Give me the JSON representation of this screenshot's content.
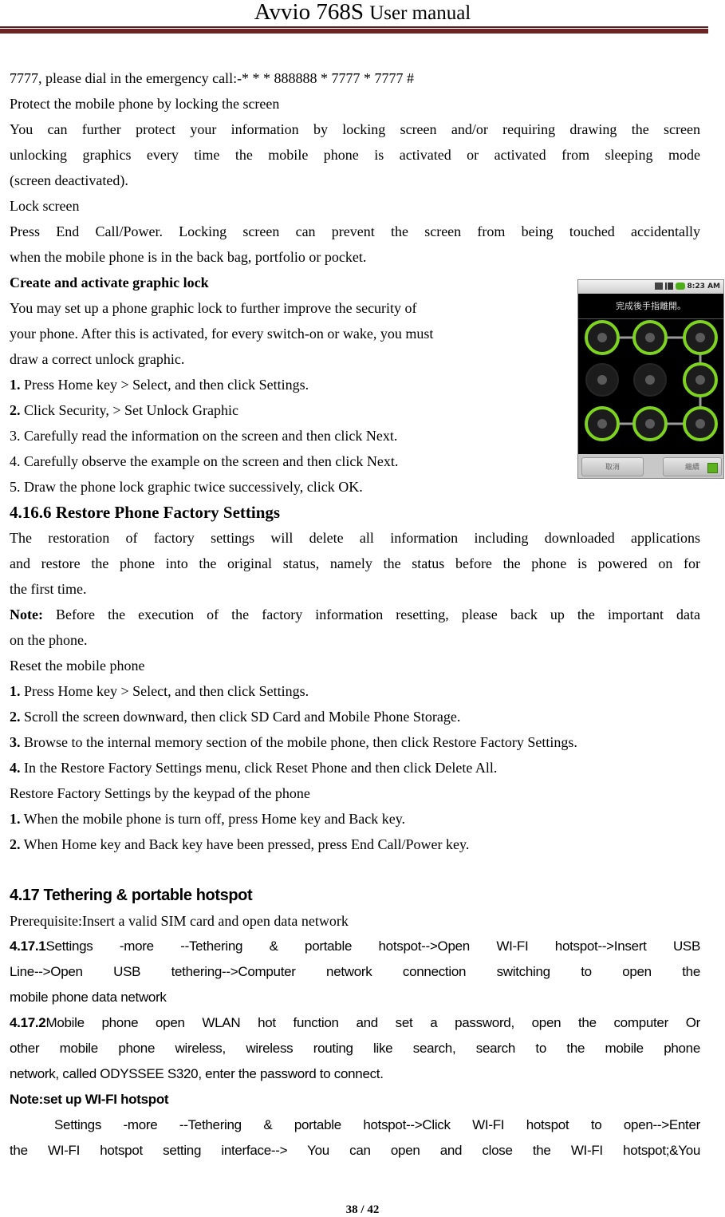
{
  "header": {
    "model": "Avvio 768S",
    "title": "User manual",
    "rule_color": "#6b2424"
  },
  "lines": {
    "l01": "7777, please dial in the emergency call:-* * * 888888 * 7777 * 7777 #",
    "l02": "Protect the mobile phone by locking the screen",
    "l03": "You can further protect your information by locking screen and/or requiring drawing the screen",
    "l04": "unlocking graphics every time the mobile phone is activated or activated from sleeping mode",
    "l05": "(screen deactivated).",
    "l06": "Lock screen",
    "l07": "Press End Call/Power. Locking screen can prevent the screen from being touched accidentally",
    "l08": "when the mobile phone is in the back bag, portfolio or pocket.",
    "l09": "Create and activate graphic lock",
    "l10": "You may set up a phone graphic lock to further improve the security of",
    "l11": "your phone. After this is activated, for every switch-on or wake, you must",
    "l12": "draw a correct unlock graphic.",
    "l13_num": "1.",
    "l13": " Press Home key > Select, and then click Settings.",
    "l14_num": "2.",
    "l14": " Click Security, > Set Unlock Graphic",
    "l15": "3. Carefully read the information on the screen and then click Next.",
    "l16": "4. Carefully observe the example on the screen and then click Next.",
    "l17": "5. Draw the phone lock graphic twice successively, click OK.",
    "l18": "4.16.6 Restore Phone Factory Settings",
    "l19": "The restoration of factory settings will delete all information including downloaded applications",
    "l20": "and restore the phone into the original status, namely the status before the phone is powered on for",
    "l21": "the first time.",
    "l22_label": "Note:",
    "l22": " Before the execution of the factory information resetting, please back up the important data",
    "l23": "on the phone.",
    "l24": "Reset the mobile phone",
    "l25_num": "1.",
    "l25": " Press Home key > Select, and then click Settings.",
    "l26_num": "2.",
    "l26": " Scroll the screen downward, then click SD Card and Mobile Phone Storage.",
    "l27_num": "3.",
    "l27": " Browse to the internal memory section of the mobile phone, then click Restore Factory Settings.",
    "l28_num": "4.",
    "l28": " In the Restore Factory Settings menu, click Reset Phone and then click Delete All.",
    "l29": "Restore Factory Settings by the keypad of the phone",
    "l30_num": "1.",
    "l30": " When the mobile phone is turn off, press Home key and Back key.",
    "l31_num": "2.",
    "l31": " When Home key and Back key have been pressed, press End Call/Power key.",
    "l32": "4.17 Tethering & portable hotspot",
    "l33": "Prerequisite:Insert a valid SIM card and open data network",
    "l34_num": "4.17.1",
    "l34": "Settings -more --Tethering & portable hotspot-->Open WI-FI hotspot-->Insert USB",
    "l35": "Line-->Open USB tethering-->Computer network connection switching to open the",
    "l36": "mobile phone data network",
    "l37_num": "4.17.2",
    "l37": "Mobile phone open WLAN hot function and set a password, open the computer Or",
    "l38": "other mobile phone wireless, wireless routing like search, search to the mobile phone",
    "l39": "network, called ODYSSEE S320, enter the password to connect.",
    "l40": "Note:set up WI-FI hotspot",
    "l41": "Settings -more --Tethering & portable hotspot-->Click WI-FI hotspot to open-->Enter",
    "l42": "the WI-FI hotspot setting interface-->      You can open and close the WI-FI hotspot;&You"
  },
  "phone_screenshot": {
    "status_time": "8:23 AM",
    "status_icons": [
      "sim-icon",
      "signal-icon",
      "battery-icon"
    ],
    "prompt": "完成後手指離開。",
    "pattern_grid": [
      [
        1,
        1,
        1
      ],
      [
        0,
        0,
        1
      ],
      [
        1,
        1,
        1
      ]
    ],
    "pattern_path": [
      [
        0,
        0
      ],
      [
        0,
        1
      ],
      [
        0,
        2
      ],
      [
        1,
        2
      ],
      [
        2,
        2
      ],
      [
        2,
        1
      ],
      [
        2,
        0
      ]
    ],
    "active_color": "#7ed321",
    "cancel_label": "取消",
    "continue_label": "繼續"
  },
  "footer": {
    "page": "38 / 42"
  }
}
